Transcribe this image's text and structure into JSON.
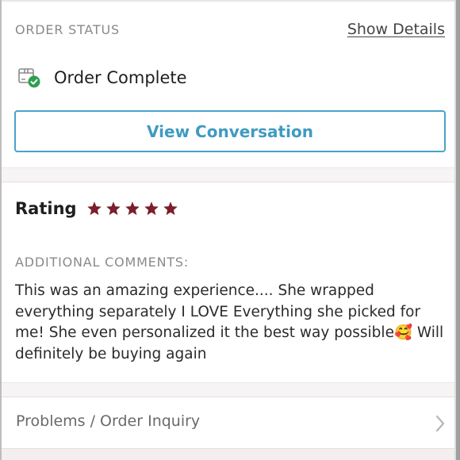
{
  "order_status": {
    "section_label": "ORDER STATUS",
    "show_details_label": "Show Details",
    "status_text": "Order Complete",
    "status_icon": "box-check-icon"
  },
  "view_conversation_label": "View Conversation",
  "rating": {
    "label": "Rating",
    "stars_filled": 5,
    "stars_total": 5,
    "star_color": "#7a1f2b"
  },
  "comments": {
    "label": "ADDITIONAL COMMENTS:",
    "text": "This was an amazing experience.... She wrapped everything separately I LOVE Everything she picked for me! She even personalized it the best way possible🥰 Will definitely be buying again"
  },
  "inquiry": {
    "label": "Problems / Order Inquiry"
  },
  "colors": {
    "accent": "#3f9bc2",
    "status_check": "#2e9e4f"
  }
}
